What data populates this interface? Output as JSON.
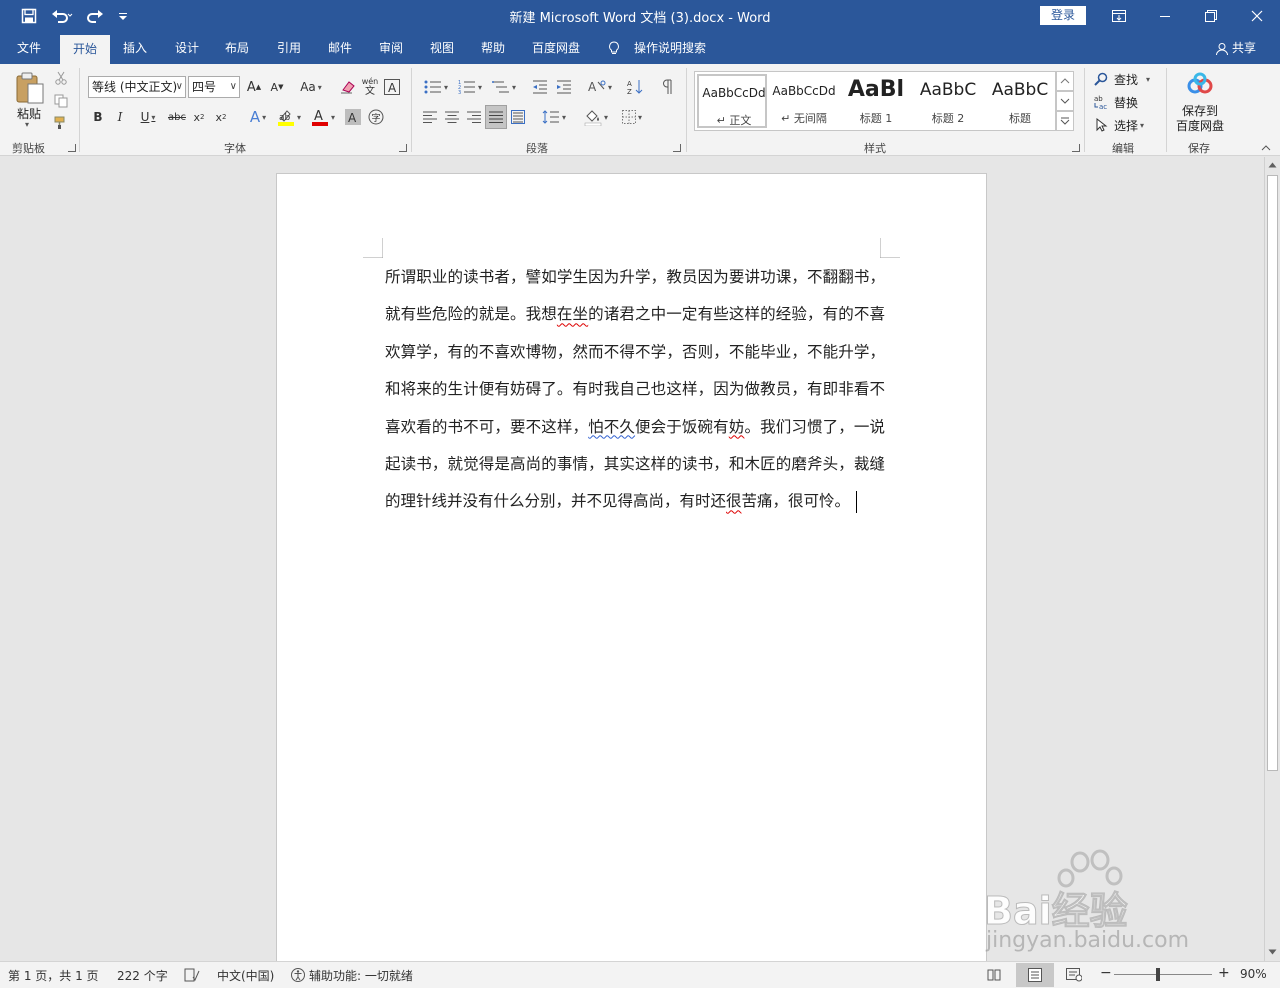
{
  "window": {
    "title": "新建 Microsoft Word 文档 (3).docx  -  Word",
    "login_label": "登录"
  },
  "tabs": [
    "文件",
    "开始",
    "插入",
    "设计",
    "布局",
    "引用",
    "邮件",
    "审阅",
    "视图",
    "帮助",
    "百度网盘"
  ],
  "active_tab": "开始",
  "tell_me": "操作说明搜索",
  "share_label": "共享",
  "ribbon": {
    "clipboard": {
      "paste_label": "粘贴",
      "group_label": "剪贴板"
    },
    "font": {
      "font_name": "等线 (中文正文)",
      "font_size": "四号",
      "group_label": "字体"
    },
    "paragraph": {
      "group_label": "段落"
    },
    "styles": {
      "group_label": "样式",
      "items": [
        {
          "sample": "AaBbCcDd",
          "name": "↵ 正文"
        },
        {
          "sample": "AaBbCcDd",
          "name": "↵ 无间隔"
        },
        {
          "sample": "AaBl",
          "name": "标题 1"
        },
        {
          "sample": "AaBbC",
          "name": "标题 2"
        },
        {
          "sample": "AaBbC",
          "name": "标题"
        }
      ]
    },
    "editing": {
      "find": "查找",
      "replace": "替换",
      "select": "选择",
      "group_label": "编辑"
    },
    "save": {
      "label": "保存到\n百度网盘",
      "label_line1": "保存到",
      "label_line2": "百度网盘",
      "group_label": "保存"
    }
  },
  "document": {
    "segments": [
      "所谓职业的读书者，譬如学生因为升学，教员因为要讲功课，不翻翻书，就有些危险的就是。我想",
      "在坐",
      "的诸君之中一定有些这样的经验，有的不喜欢算学，有的不喜欢博物，然而不得不学，否则，不能毕业，不能升学，和将来的生计便有妨碍了。有时我自己也这样，因为做教员，有即非看不喜欢看的书不可，要不这样，",
      "怕不久",
      "便会于饭碗有",
      "妨",
      "。我们习惯了，一说起读书，就觉得是高尚的事情，其实这样的读书，和木匠的磨斧头，裁缝的理针线并没有什么分别，并不见得高尚，有时还",
      "很",
      "苦痛，很可怜。"
    ]
  },
  "statusbar": {
    "page": "第 1 页，共 1 页",
    "words": "222 个字",
    "language": "中文(中国)",
    "accessibility": "辅助功能: 一切就绪",
    "zoom": "90%",
    "zoom_level": 0.9
  },
  "watermark": {
    "text": "Bai经验",
    "url": "jingyan.baidu.com"
  },
  "colors": {
    "accent": "#2b579a",
    "ribbon": "#f3f3f3",
    "canvas": "#e6e6e6"
  }
}
